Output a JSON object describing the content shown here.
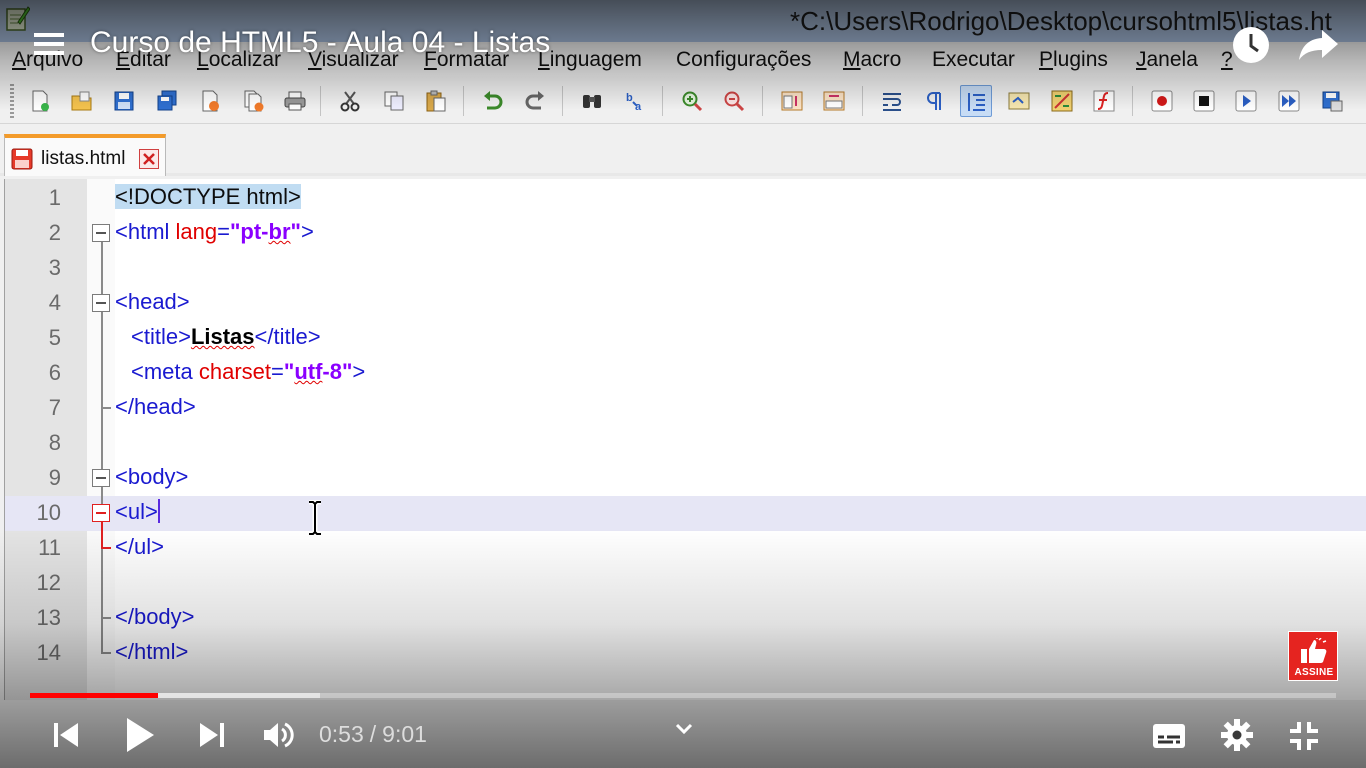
{
  "window": {
    "title": "*C:\\Users\\Rodrigo\\Desktop\\cursohtml5\\listas.ht"
  },
  "menu": [
    {
      "label": "Arquivo",
      "ul": "A",
      "rest": "rquivo"
    },
    {
      "label": "Editar",
      "ul": "E",
      "rest": "ditar"
    },
    {
      "label": "Localizar",
      "ul": "L",
      "rest": "ocalizar"
    },
    {
      "label": "Visualizar",
      "ul": "V",
      "rest": "isualizar"
    },
    {
      "label": "Formatar",
      "ul": "F",
      "rest": "ormatar"
    },
    {
      "label": "Linguagem",
      "ul": "L",
      "rest": "inguagem"
    },
    {
      "label": "Configurações",
      "ul": "",
      "rest": "Configurações"
    },
    {
      "label": "Macro",
      "ul": "M",
      "rest": "acro"
    },
    {
      "label": "Executar",
      "ul": "",
      "rest": "Executar"
    },
    {
      "label": "Plugins",
      "ul": "P",
      "rest": "lugins"
    },
    {
      "label": "Janela",
      "ul": "J",
      "rest": "anela"
    },
    {
      "label": "?",
      "ul": "?",
      "rest": ""
    }
  ],
  "toolbar": {
    "buttons": [
      "new-file",
      "open-file",
      "save",
      "save-all",
      "close",
      "close-all",
      "print",
      "cut",
      "copy",
      "paste",
      "undo",
      "redo",
      "find",
      "replace",
      "zoom-in",
      "zoom-out",
      "sync-vertical",
      "sync-horizontal",
      "word-wrap",
      "show-all-characters",
      "indent-guide",
      "document-map",
      "function-list",
      "folder-as-workspace",
      "record-macro",
      "stop-recording",
      "playback-macro",
      "run-macro-multiple",
      "save-macro"
    ]
  },
  "tab": {
    "filename": "listas.html"
  },
  "editor": {
    "current_line": 10,
    "lines": [
      {
        "n": "1"
      },
      {
        "n": "2"
      },
      {
        "n": "3"
      },
      {
        "n": "4"
      },
      {
        "n": "5"
      },
      {
        "n": "6"
      },
      {
        "n": "7"
      },
      {
        "n": "8"
      },
      {
        "n": "9"
      },
      {
        "n": "10"
      },
      {
        "n": "11"
      },
      {
        "n": "12"
      },
      {
        "n": "13"
      },
      {
        "n": "14"
      }
    ],
    "code": {
      "l1": "<!DOCTYPE html>",
      "l2_open": "<html ",
      "l2_attr": "lang",
      "l2_eq": "=",
      "l2_val_a": "\"pt-",
      "l2_val_b": "br",
      "l2_val_c": "\"",
      "l2_close": ">",
      "l4": "<head>",
      "l5_open": "<title>",
      "l5_text": "Listas",
      "l5_close": "</title>",
      "l6_open": "<meta ",
      "l6_attr": "charset",
      "l6_eq": "=",
      "l6_val_a": "\"",
      "l6_val_b": "utf",
      "l6_val_c": "-8\"",
      "l6_close": ">",
      "l7": "</head>",
      "l9": "<body>",
      "l10": "<ul>",
      "l11": "</ul>",
      "l13": "</body>",
      "l14": "</html>"
    }
  },
  "player": {
    "video_title": "Curso de HTML5 - Aula 04 - Listas",
    "current_time": "0:53",
    "time_separator": "/",
    "duration": "9:01",
    "played_fraction": 0.098,
    "buffered_fraction": 0.222,
    "subscribe_label": "ASSINE",
    "accent_color": "#ff0000"
  }
}
